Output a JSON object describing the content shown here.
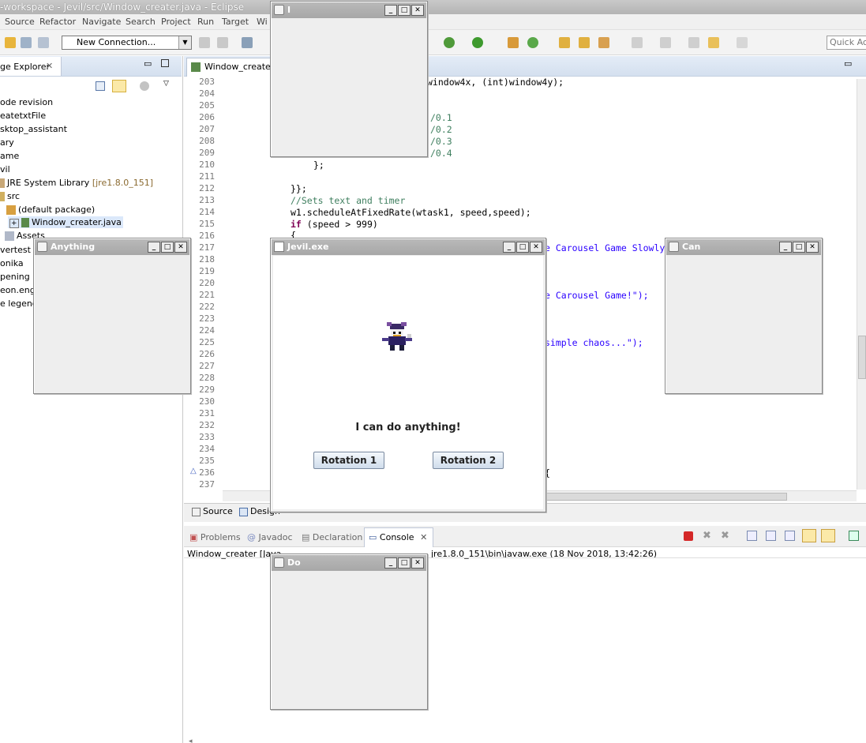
{
  "window_title": "-workspace - Jevil/src/Window_creater.java - Eclipse",
  "menu": [
    "Source",
    "Refactor",
    "Navigate",
    "Search",
    "Project",
    "Run",
    "Target",
    "Wi"
  ],
  "toolbar": {
    "connection_combo": "New Connection...",
    "quick_access": "Quick Acc"
  },
  "package_explorer": {
    "tab_label": "ge Explorer",
    "items": [
      {
        "label": "ode revision",
        "extra": ""
      },
      {
        "label": "eatetxtFile",
        "extra": ""
      },
      {
        "label": "sktop_assistant",
        "extra": ""
      },
      {
        "label": "ary",
        "extra": ""
      },
      {
        "label": "ame",
        "extra": ""
      },
      {
        "label": "vil",
        "extra": ""
      },
      {
        "label": "JRE System Library",
        "extra": "[jre1.8.0_151]"
      },
      {
        "label": "src",
        "extra": ""
      },
      {
        "label": "(default package)",
        "extra": ""
      },
      {
        "label": "Window_creater.java",
        "extra": ""
      },
      {
        "label": "Assets",
        "extra": ""
      },
      {
        "label": "vertest",
        "extra": ""
      },
      {
        "label": "onika",
        "extra": ""
      },
      {
        "label": "pening",
        "extra": ""
      },
      {
        "label": "eon.engi",
        "extra": ""
      },
      {
        "label": "e legend",
        "extra": ""
      }
    ]
  },
  "editor": {
    "tab_label": "Window_creater.",
    "line_numbers": [
      "203",
      "204",
      "205",
      "206",
      "207",
      "208",
      "209",
      "210",
      "211",
      "212",
      "213",
      "214",
      "215",
      "216",
      "217",
      "218",
      "219",
      "220",
      "221",
      "222",
      "223",
      "224",
      "225",
      "226",
      "227",
      "228",
      "229",
      "230",
      "231",
      "232",
      "233",
      "234",
      "235",
      "236",
      "237"
    ],
    "code": {
      "l203": "window4x, (int)window4y);",
      "l206": "/0.1",
      "l207": "/0.2",
      "l208": "/0.3",
      "l209": "/0.4",
      "l210": "};",
      "l212": "}};",
      "l213": "//Sets text and timer",
      "l214_a": "w1.scheduleAtFixedRate(wtask1, speed,speed);",
      "l215_kw": "if",
      "l215_rest": " (speed > 999)",
      "l216": "{",
      "l217": "e Carousel Game Slowly",
      "l221": "e Carousel Game!\");",
      "l225": "simple chaos...\");",
      "l236": "{"
    },
    "bottom_tabs": [
      "Source",
      "Design"
    ]
  },
  "console": {
    "tabs": [
      "Problems",
      "Javadoc",
      "Declaration",
      "Console"
    ],
    "active_tab": "Console",
    "line_left": "Window_creater [Java",
    "line_right": "jre1.8.0_151\\bin\\javaw.exe (18 Nov 2018, 13:42:26)"
  },
  "windows": {
    "i": {
      "title": "I"
    },
    "anything": {
      "title": "Anything"
    },
    "can": {
      "title": "Can"
    },
    "do": {
      "title": "Do"
    },
    "jevil": {
      "title": "Jevil.exe",
      "message": "I can do anything!",
      "button1": "Rotation 1",
      "button2": "Rotation 2"
    }
  },
  "window_controls": {
    "minimize": "_",
    "maximize": "□",
    "close": "✕"
  }
}
